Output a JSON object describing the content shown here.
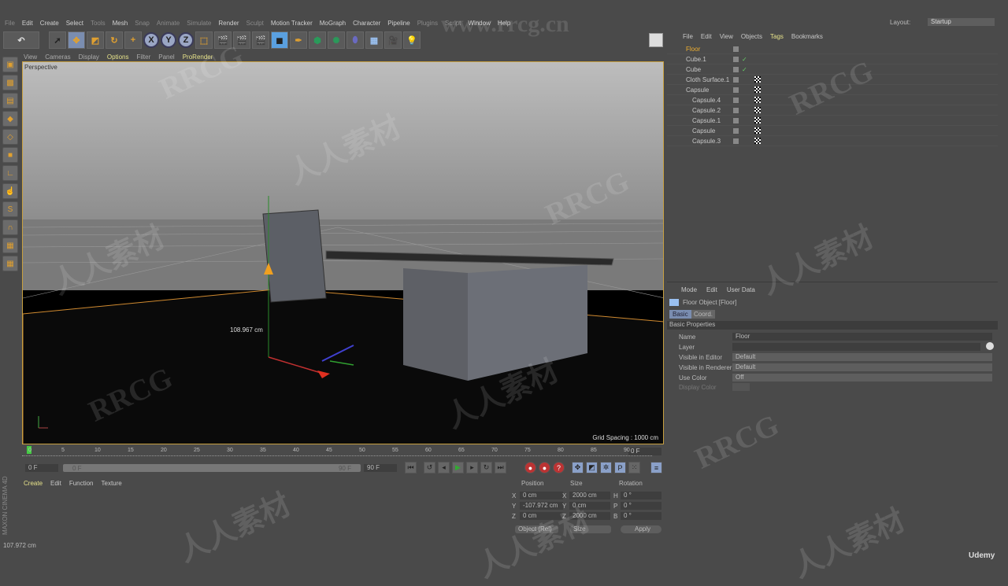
{
  "menu": [
    "File",
    "Edit",
    "Create",
    "Select",
    "Tools",
    "Mesh",
    "Snap",
    "Animate",
    "Simulate",
    "Render",
    "Sculpt",
    "Motion Tracker",
    "MoGraph",
    "Character",
    "Pipeline",
    "Plugins",
    "Script",
    "Window",
    "Help"
  ],
  "layout": {
    "label": "Layout:",
    "value": "Startup"
  },
  "toolbar": {
    "x": "X",
    "y": "Y",
    "z": "Z"
  },
  "viewport": {
    "menu": [
      "View",
      "Cameras",
      "Display",
      "Options",
      "Filter",
      "Panel",
      "ProRender"
    ],
    "camera": "Perspective",
    "measure": "108.967 cm",
    "grid_spacing": "Grid Spacing : 1000 cm"
  },
  "object_manager": {
    "menu": [
      "File",
      "Edit",
      "View",
      "Objects",
      "Tags",
      "Bookmarks"
    ],
    "objects": [
      {
        "name": "Floor"
      },
      {
        "name": "Cube.1"
      },
      {
        "name": "Cube"
      },
      {
        "name": "Cloth Surface.1"
      },
      {
        "name": "Capsule"
      },
      {
        "name": "Capsule.4"
      },
      {
        "name": "Capsule.2"
      },
      {
        "name": "Capsule.1"
      },
      {
        "name": "Capsule"
      },
      {
        "name": "Capsule.3"
      }
    ]
  },
  "attributes": {
    "menu": [
      "Mode",
      "Edit",
      "User Data"
    ],
    "title": "Floor Object [Floor]",
    "tabs": [
      "Basic",
      "Coord."
    ],
    "section": "Basic Properties",
    "fields": [
      {
        "label": "Name",
        "value": "Floor"
      },
      {
        "label": "Layer",
        "value": ""
      },
      {
        "label": "Visible in Editor",
        "value": "Default"
      },
      {
        "label": "Visible in Renderer",
        "value": "Default"
      },
      {
        "label": "Use Color",
        "value": "Off"
      },
      {
        "label": "Display Color",
        "value": ""
      }
    ]
  },
  "timeline": {
    "ticks": [
      "0",
      "5",
      "10",
      "15",
      "20",
      "25",
      "30",
      "35",
      "40",
      "45",
      "50",
      "55",
      "60",
      "65",
      "70",
      "75",
      "80",
      "85",
      "90"
    ],
    "current_frame": "0 F",
    "start": "0 F",
    "range_start": "0 F",
    "range_end": "90 F",
    "end": "90 F"
  },
  "materials": {
    "menu": [
      "Create",
      "Edit",
      "Function",
      "Texture"
    ]
  },
  "coordinates": {
    "headers": [
      "Position",
      "Size",
      "Rotation"
    ],
    "rows": [
      {
        "axis": "X",
        "pos": "0 cm",
        "saxis": "X",
        "size": "2000 cm",
        "raxis": "H",
        "rot": "0 °"
      },
      {
        "axis": "Y",
        "pos": "-107.972 cm",
        "saxis": "Y",
        "size": "0 cm",
        "raxis": "P",
        "rot": "0 °"
      },
      {
        "axis": "Z",
        "pos": "0 cm",
        "saxis": "Z",
        "size": "2000 cm",
        "raxis": "B",
        "rot": "0 °"
      }
    ],
    "mode": "Object (Rel)",
    "size_mode": "Size",
    "apply": "Apply"
  },
  "status": "107.972 cm",
  "branding": {
    "maxon": "MAXON CINEMA 4D",
    "udemy": "Udemy",
    "watermark": "RRCG 人人素材",
    "site": "www.rrcg.cn"
  }
}
